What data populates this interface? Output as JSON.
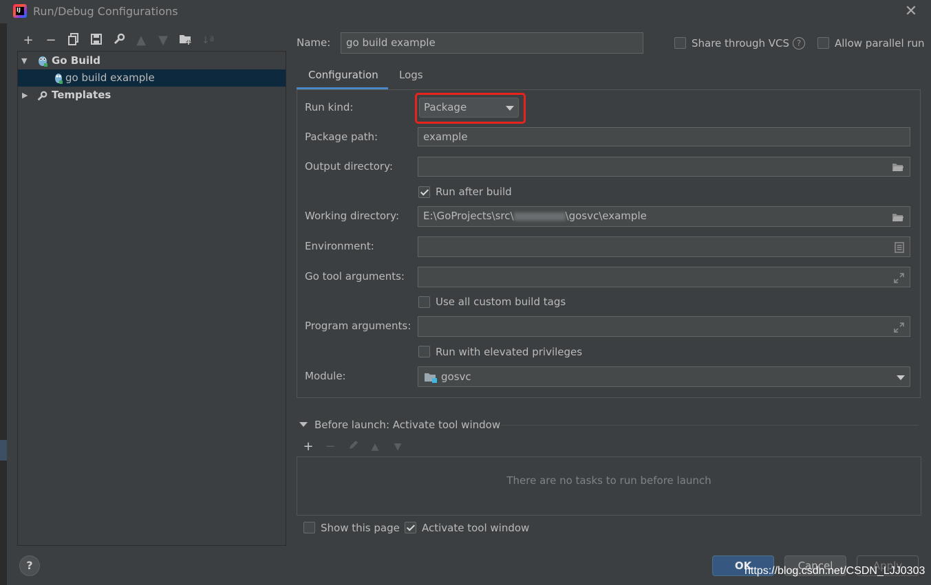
{
  "window": {
    "title": "Run/Debug Configurations",
    "close_icon": "close-icon"
  },
  "toolbar": {
    "icons": [
      "add-icon",
      "remove-icon",
      "copy-icon",
      "save-icon",
      "wrench-icon",
      "move-up-icon",
      "move-down-icon",
      "folder-add-icon",
      "sort-icon"
    ],
    "add": "+",
    "remove": "−"
  },
  "tree": {
    "group_label": "Go Build",
    "item_label": "go build example",
    "templates_label": "Templates"
  },
  "header": {
    "name_label": "Name:",
    "name_value": "go build example",
    "share_vcs_label": "Share through VCS",
    "share_vcs_checked": false,
    "parallel_label": "Allow parallel run",
    "parallel_checked": false
  },
  "tabs": [
    {
      "label": "Configuration",
      "active": true
    },
    {
      "label": "Logs",
      "active": false
    }
  ],
  "config": {
    "run_kind_label": "Run kind:",
    "run_kind_value": "Package",
    "package_path_label": "Package path:",
    "package_path_value": "example",
    "output_dir_label": "Output directory:",
    "output_dir_value": "",
    "run_after_build_label": "Run after build",
    "run_after_build_checked": true,
    "working_dir_label": "Working directory:",
    "working_dir_value": "E:\\GoProjects\\src\\",
    "working_dir_value_end": "\\gosvc\\example",
    "environment_label": "Environment:",
    "environment_value": "",
    "go_tool_args_label": "Go tool arguments:",
    "go_tool_args_value": "",
    "custom_build_tags_label": "Use all custom build tags",
    "custom_build_tags_checked": false,
    "program_args_label": "Program arguments:",
    "program_args_value": "",
    "elevated_label": "Run with elevated privileges",
    "elevated_checked": false,
    "module_label": "Module:",
    "module_value": "gosvc"
  },
  "before_launch": {
    "title": "Before launch: Activate tool window",
    "empty_text": "There are no tasks to run before launch"
  },
  "footer": {
    "show_page_label": "Show this page",
    "show_page_checked": false,
    "activate_tool_label": "Activate tool window",
    "activate_tool_checked": true,
    "ok_label": "OK",
    "cancel_label": "Cancel",
    "apply_label": "Apply",
    "help_label": "?",
    "watermark": "https://blog.csdn.net/CSDN_LJJ0303"
  },
  "colors": {
    "background": "#3c3f41",
    "selection": "#0d293e",
    "accent": "#4a88c7",
    "highlight": "#e8231e",
    "ok_button": "#365880"
  }
}
